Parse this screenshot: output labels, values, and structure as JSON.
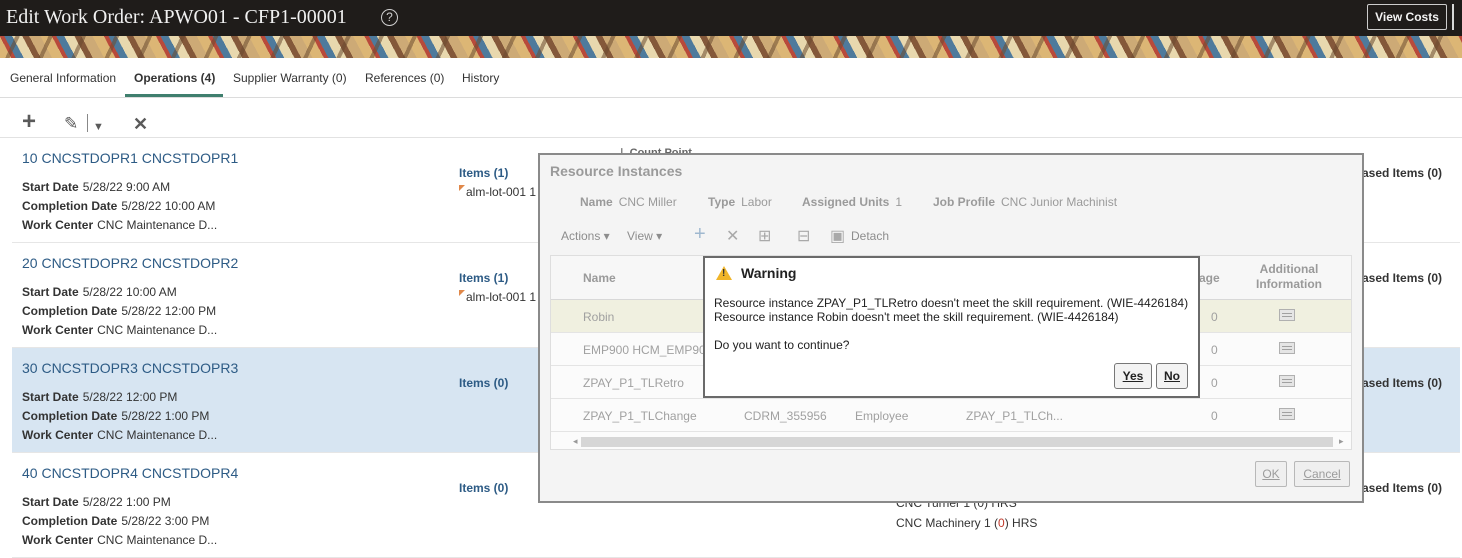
{
  "header": {
    "title": "Edit Work Order: APWO01 - CFP1-00001",
    "help_icon": "?",
    "view_costs": "View Costs"
  },
  "tabs": [
    {
      "label": "General Information",
      "active": false
    },
    {
      "label": "Operations (4)",
      "active": true
    },
    {
      "label": "Supplier Warranty (0)",
      "active": false
    },
    {
      "label": "References (0)",
      "active": false
    },
    {
      "label": "History",
      "active": false
    }
  ],
  "toolbar": {
    "add_icon": "plus-icon",
    "edit_icon": "pencil-icon",
    "delete_icon": "close-icon"
  },
  "labels": {
    "start_date": "Start Date",
    "completion_date": "Completion Date",
    "work_center": "Work Center"
  },
  "operations": [
    {
      "title": "10 CNCSTDOPR1 CNCSTDOPR1",
      "start": "5/28/22 9:00 AM",
      "completion": "5/28/22 10:00 AM",
      "work_center": "CNC Maintenance D...",
      "items": "Items (1)",
      "lot": "alm-lot-001  1",
      "purchased": "ased Items (0)",
      "selected": false
    },
    {
      "title": "20 CNCSTDOPR2 CNCSTDOPR2",
      "start": "5/28/22 10:00 AM",
      "completion": "5/28/22 12:00 PM",
      "work_center": "CNC Maintenance D...",
      "items": "Items (1)",
      "lot": "alm-lot-001  1",
      "purchased": "ased Items (0)",
      "selected": false
    },
    {
      "title": "30 CNCSTDOPR3 CNCSTDOPR3",
      "start": "5/28/22 12:00 PM",
      "completion": "5/28/22 1:00 PM",
      "work_center": "CNC Maintenance D...",
      "items": "Items (0)",
      "lot": "",
      "purchased": "ased Items (0)",
      "selected": true
    },
    {
      "title": "40 CNCSTDOPR4 CNCSTDOPR4",
      "start": "5/28/22 1:00 PM",
      "completion": "5/28/22 3:00 PM",
      "work_center": "CNC Maintenance D...",
      "items": "Items (0)",
      "lot": "",
      "purchased": "ased Items (0)",
      "selected": false
    }
  ],
  "peek": {
    "count_point": "Count Point",
    "res_turner": "CNC Turner  1 (0) HRS",
    "res_machinery_name": "CNC Machinery  1 (",
    "res_machinery_num": "0",
    "res_machinery_unit": ") HRS"
  },
  "resource_dialog": {
    "title": "Resource Instances",
    "name_label": "Name",
    "name_value": "CNC Miller",
    "type_label": "Type",
    "type_value": "Labor",
    "units_label": "Assigned Units",
    "units_value": "1",
    "job_label": "Job Profile",
    "job_value": "CNC Junior Machinist",
    "actions_label": "Actions ▾",
    "view_label": "View ▾",
    "detach_label": "Detach",
    "col_name": "Name",
    "col_usage": "age",
    "col_additional_1": "Additional",
    "col_additional_2": "Information",
    "rows": [
      {
        "name": "Robin",
        "c2": "",
        "c3": "",
        "c4": "",
        "usage": "0"
      },
      {
        "name": "EMP900 HCM_EMP90",
        "c2": "",
        "c3": "",
        "c4": "",
        "usage": "0"
      },
      {
        "name": "ZPAY_P1_TLRetro",
        "c2": "",
        "c3": "",
        "c4": "",
        "usage": "0"
      },
      {
        "name": "ZPAY_P1_TLChange",
        "c2": "CDRM_355956",
        "c3": "Employee",
        "c4": "ZPAY_P1_TLCh...",
        "usage": "0"
      }
    ],
    "ok_label": "OK",
    "cancel_label": "Cancel"
  },
  "warning": {
    "title": "Warning",
    "message1": "Resource instance ZPAY_P1_TLRetro doesn't meet the skill requirement. (WIE-4426184)",
    "message2": "Resource instance Robin doesn't meet the skill requirement. (WIE-4426184)",
    "question": "Do you want to continue?",
    "yes_label": "Yes",
    "no_label": "No"
  }
}
